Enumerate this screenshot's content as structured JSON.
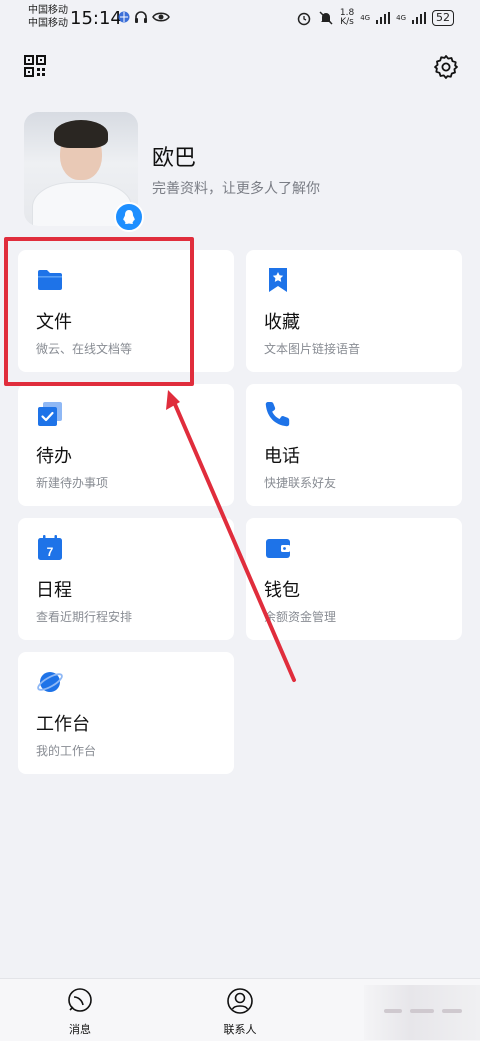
{
  "status_bar": {
    "carrier_1": "中国移动",
    "carrier_2": "中国移动",
    "time": "15:14",
    "net_speed_value": "1.8",
    "net_speed_unit": "K/s",
    "signal_1": "4G",
    "signal_2": "4G",
    "battery": "52"
  },
  "header": {
    "qr_icon": "qr-code-icon",
    "settings_icon": "gear-icon"
  },
  "profile": {
    "name": "欧巴",
    "subtitle": "完善资料，让更多人了解你"
  },
  "cards": [
    {
      "title": "文件",
      "subtitle": "微云、在线文档等",
      "icon": "folder-icon"
    },
    {
      "title": "收藏",
      "subtitle": "文本图片链接语音",
      "icon": "bookmark-star-icon"
    },
    {
      "title": "待办",
      "subtitle": "新建待办事项",
      "icon": "todo-check-icon"
    },
    {
      "title": "电话",
      "subtitle": "快捷联系好友",
      "icon": "phone-icon"
    },
    {
      "title": "日程",
      "subtitle": "查看近期行程安排",
      "icon": "calendar-icon",
      "icon_text": "7"
    },
    {
      "title": "钱包",
      "subtitle": "余额资金管理",
      "icon": "wallet-icon"
    },
    {
      "title": "工作台",
      "subtitle": "我的工作台",
      "icon": "planet-icon"
    }
  ],
  "bottom_nav": [
    {
      "label": "消息",
      "icon": "message-icon"
    },
    {
      "label": "联系人",
      "icon": "contacts-icon"
    }
  ],
  "colors": {
    "accent_blue": "#1e73e8",
    "annotation_red": "#e02d3c",
    "background": "#f1f2f6"
  }
}
